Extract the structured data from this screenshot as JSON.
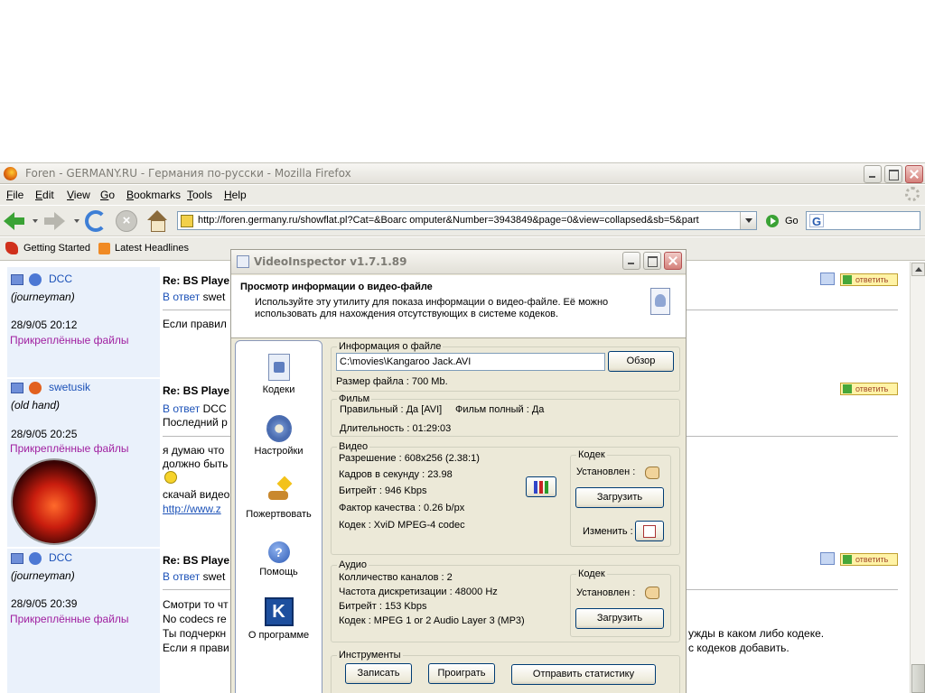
{
  "browser": {
    "window_title": "Foren - GERMANY.RU - Германия по-русски - Mozilla Firefox",
    "menu": [
      {
        "key": "F",
        "rest": "ile"
      },
      {
        "key": "E",
        "rest": "dit"
      },
      {
        "key": "V",
        "rest": "iew"
      },
      {
        "key": "G",
        "rest": "o"
      },
      {
        "key": "B",
        "rest": "ookmarks"
      },
      {
        "key": "T",
        "rest": "ools"
      },
      {
        "key": "H",
        "rest": "elp"
      }
    ],
    "url": "http://foren.germany.ru/showflat.pl?Cat=&Boarc    omputer&Number=3943849&page=0&view=collapsed&sb=5&part",
    "go_label": "Go",
    "search_engine": "G",
    "bookmarks": [
      "Getting Started",
      "Latest Headlines"
    ],
    "icons": {
      "back": "back-arrow-icon",
      "forward": "forward-arrow-icon",
      "reload": "reload-icon",
      "stop": "stop-icon",
      "home": "home-icon"
    }
  },
  "forum": {
    "posts": [
      {
        "user": "DCC",
        "rank": "(journeyman)",
        "date": "28/9/05 20:12",
        "attach": "Прикреплённые файлы",
        "title": "Re: BS Playe",
        "reply_prefix": "В ответ",
        "reply_to": "swet",
        "lines": [
          "Если правил"
        ]
      },
      {
        "user": "swetusik",
        "rank": "(old hand)",
        "date": "28/9/05 20:25",
        "attach": "Прикреплённые файлы",
        "title": "Re: BS Playe",
        "reply_prefix": "В ответ",
        "reply_to": "DCC",
        "lines": [
          "Последний р",
          "я думаю что",
          "должно быть",
          "скачай видео",
          "http://www.z"
        ]
      },
      {
        "user": "DCC",
        "rank": "(journeyman)",
        "date": "28/9/05 20:39",
        "attach": "Прикреплённые файлы",
        "title": "Re: BS Playe",
        "reply_prefix": "В ответ",
        "reply_to": "swet",
        "lines": [
          "Смотри то чт",
          "No codecs re",
          "Ты подчеркн",
          "Если я прави"
        ],
        "right_lines": [
          "ужды в каком либо кодеке.",
          "с кодеков добавить."
        ]
      }
    ],
    "reply_label": "ответить"
  },
  "vi": {
    "title": "VideoInspector v1.7.1.89",
    "header_title": "Просмотр информации о видео-файле",
    "header_desc": "Используйте эту утилиту для показа информации о видео-файле. Её можно использовать для нахождения отсутствующих в системе кодеков.",
    "nav": [
      "Кодеки",
      "Настройки",
      "Пожертвовать",
      "Помощь",
      "О программе"
    ],
    "file_group": "Информация о файле",
    "file_path": "C:\\movies\\Kangaroo Jack.AVI",
    "browse": "Обзор",
    "file_size": "Размер файла : 700 Mb.",
    "film_group": "Фильм",
    "film_valid": "Правильный : Да [AVI]",
    "film_full": "Фильм полный : Да",
    "film_duration": "Длительность : 01:29:03",
    "video_group": "Видео",
    "video_lines": [
      "Разрешение : 608x256 (2.38:1)",
      "Кадров в секунду : 23.98",
      "Битрейт : 946 Kbps",
      "Фактор качества : 0.26 b/px",
      "Кодек : XviD MPEG-4 codec"
    ],
    "codec_group": "Кодек",
    "installed": "Установлен :",
    "download": "Загрузить",
    "change": "Изменить :",
    "audio_group": "Аудио",
    "audio_lines": [
      "Колличество каналов : 2",
      "Частота дискретизации : 48000 Hz",
      "Битрейт : 153 Kbps",
      "Кодек : MPEG 1 or 2 Audio Layer 3 (MP3)"
    ],
    "tools_group": "Инструменты",
    "tools": [
      "Записать",
      "Проиграть",
      "Отправить статистику"
    ]
  }
}
